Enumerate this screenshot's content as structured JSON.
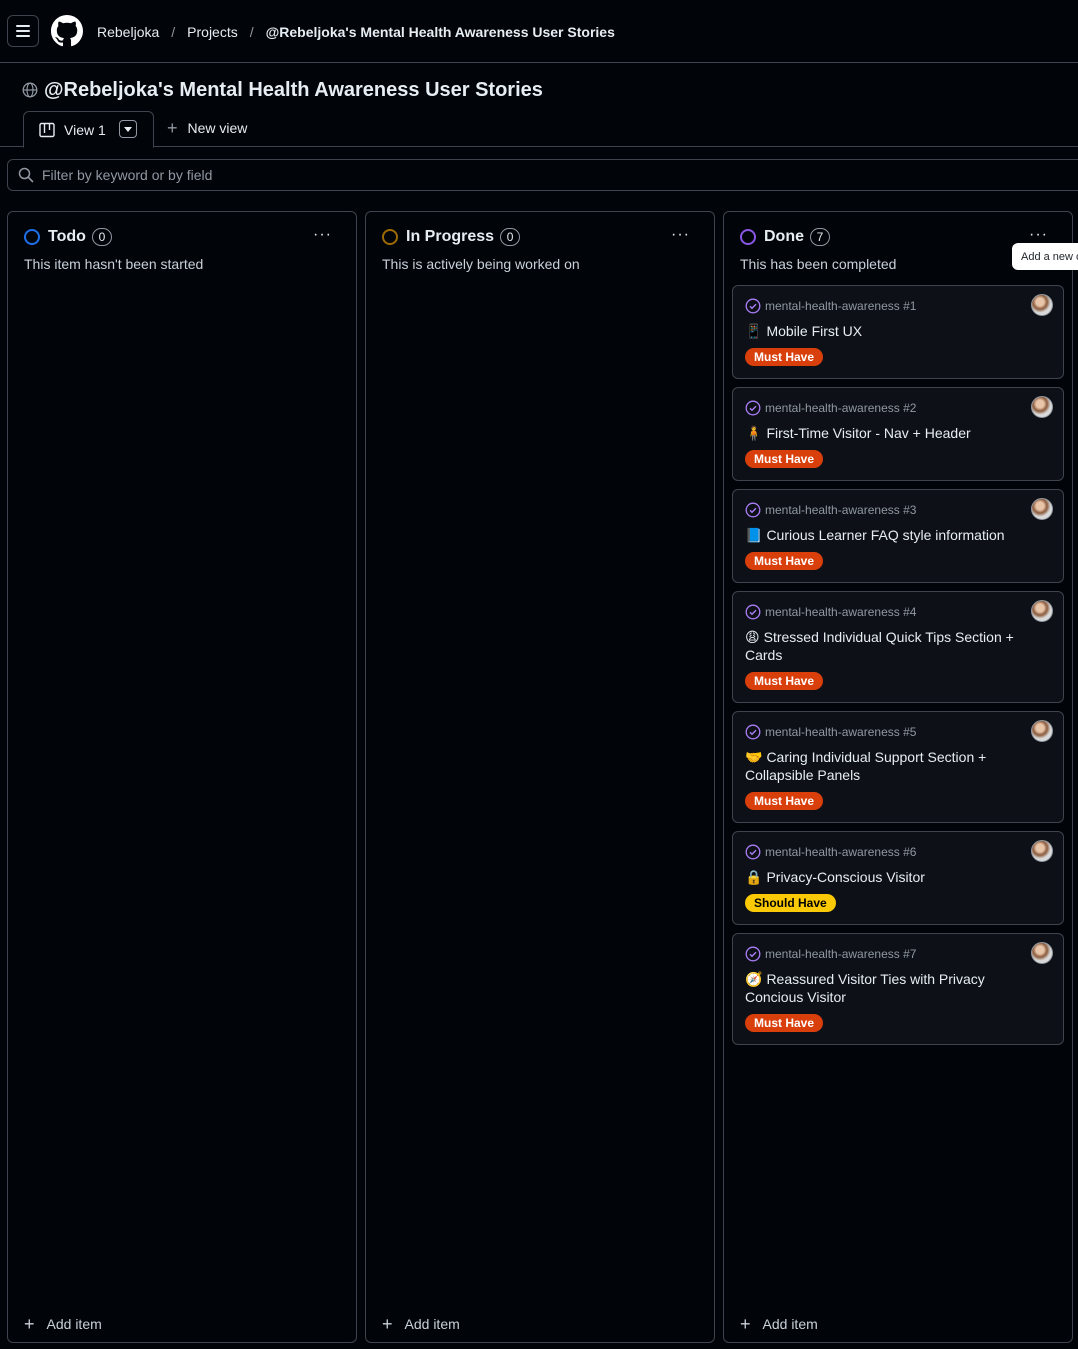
{
  "nav": {
    "breadcrumbs": [
      "Rebeljoka",
      "Projects",
      "@Rebeljoka's Mental Health Awareness User Stories"
    ],
    "separator": "/"
  },
  "project": {
    "title": "@Rebeljoka's Mental Health Awareness User Stories"
  },
  "views": {
    "current": "View 1",
    "new_view": "New view"
  },
  "filter": {
    "placeholder": "Filter by keyword or by field"
  },
  "columns": [
    {
      "name": "Todo",
      "count": "0",
      "description": "This item hasn't been started",
      "color": "#1f6feb",
      "add_item": "Add item",
      "menu": "···"
    },
    {
      "name": "In Progress",
      "count": "0",
      "description": "This is actively being worked on",
      "color": "#9e6a03",
      "add_item": "Add item",
      "menu": "···"
    },
    {
      "name": "Done",
      "count": "7",
      "description": "This has been completed",
      "color": "#8957e5",
      "add_item": "Add item",
      "menu": "···"
    }
  ],
  "cards": [
    {
      "ref": "mental-health-awareness #1",
      "emoji": "📱",
      "title": "Mobile First UX",
      "label": "Must Have",
      "label_color": "#d93f0b"
    },
    {
      "ref": "mental-health-awareness #2",
      "emoji": "🧍",
      "title": "First-Time Visitor - Nav + Header",
      "label": "Must Have",
      "label_color": "#d93f0b"
    },
    {
      "ref": "mental-health-awareness #3",
      "emoji": "📘",
      "title": "Curious Learner FAQ style information",
      "label": "Must Have",
      "label_color": "#d93f0b"
    },
    {
      "ref": "mental-health-awareness #4",
      "emoji": "😩",
      "title": "Stressed Individual Quick Tips Section + Cards",
      "label": "Must Have",
      "label_color": "#d93f0b"
    },
    {
      "ref": "mental-health-awareness #5",
      "emoji": "🤝",
      "title": "Caring Individual Support Section + Collapsible Panels",
      "label": "Must Have",
      "label_color": "#d93f0b"
    },
    {
      "ref": "mental-health-awareness #6",
      "emoji": "🔒",
      "title": "Privacy-Conscious Visitor",
      "label": "Should Have",
      "label_color": "#fbca04"
    },
    {
      "ref": "mental-health-awareness #7",
      "emoji": "🧭",
      "title": "Reassured Visitor Ties with Privacy Concious Visitor",
      "label": "Must Have",
      "label_color": "#d93f0b"
    }
  ],
  "tooltip": "Add a new c"
}
